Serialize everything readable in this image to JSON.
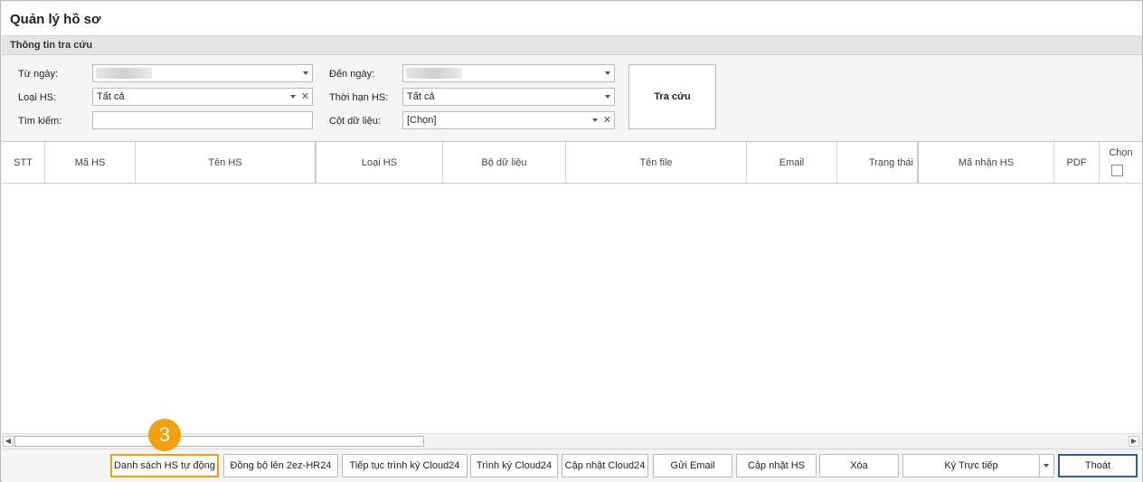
{
  "window": {
    "title": "Quản lý hồ sơ"
  },
  "filter": {
    "section_title": "Thông tin tra cứu",
    "from_date_label": "Từ ngày:",
    "to_date_label": "Đến ngày:",
    "type_label": "Loại HS:",
    "type_value": "Tất cả",
    "period_label": "Thời hạn HS:",
    "period_value": "Tất cả",
    "search_label": "Tìm kiếm:",
    "search_value": "",
    "column_label": "Cột dữ liệu:",
    "column_value": "[Chọn]",
    "search_button": "Tra cứu"
  },
  "grid": {
    "columns": [
      "STT",
      "Mã HS",
      "Tên HS",
      "Loại HS",
      "Bộ dữ liệu",
      "Tên file",
      "Email",
      "Trạng thái",
      "Mã nhận HS",
      "PDF",
      "Chọn"
    ],
    "rows": []
  },
  "toolbar": {
    "auto_list": "Danh sách HS tự động",
    "sync": "Đồng bộ lên 2ez-HR24",
    "continue_sign": "Tiếp tục trình ký Cloud24",
    "submit_sign": "Trình ký Cloud24",
    "update_cloud": "Cập nhật Cloud24",
    "send_email": "Gửi Email",
    "update_hs": "Cập nhật HS",
    "delete": "Xóa",
    "sign_direct": "Ký Trực tiếp",
    "exit": "Thoát"
  },
  "annotation": {
    "step": "3",
    "color": "#f2a10c"
  },
  "colors": {
    "accent_border": "#f2a10c",
    "focus_border": "#2c5f9e"
  }
}
